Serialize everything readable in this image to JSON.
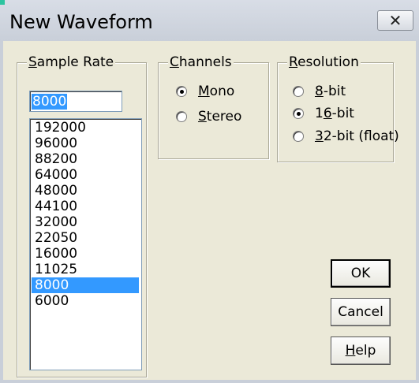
{
  "window": {
    "title": "New Waveform",
    "close_glyph": "✕"
  },
  "sample_rate": {
    "legend_access": "S",
    "legend_rest": "ample Rate",
    "input_value": "8000",
    "options": [
      "192000",
      "96000",
      "88200",
      "64000",
      "48000",
      "44100",
      "32000",
      "22050",
      "16000",
      "11025",
      "8000",
      "6000"
    ],
    "selected": "8000"
  },
  "channels": {
    "legend_access": "C",
    "legend_rest": "hannels",
    "options": [
      {
        "access": "M",
        "rest": "ono",
        "checked": true
      },
      {
        "access": "S",
        "rest": "tereo",
        "checked": false
      }
    ]
  },
  "resolution": {
    "legend_access": "R",
    "legend_rest": "esolution",
    "options": [
      {
        "access": "8",
        "rest": "-bit",
        "pre": "",
        "checked": false
      },
      {
        "pre": "1",
        "access": "6",
        "rest": "-bit",
        "checked": true
      },
      {
        "access": "3",
        "rest": "2-bit (float)",
        "pre": "",
        "checked": false
      }
    ]
  },
  "buttons": {
    "ok": "OK",
    "cancel": "Cancel",
    "help_access": "H",
    "help_rest": "elp"
  },
  "colors": {
    "face": "#ebe9d8",
    "selection": "#3399ff",
    "title_accent": "#2cc4a0"
  }
}
